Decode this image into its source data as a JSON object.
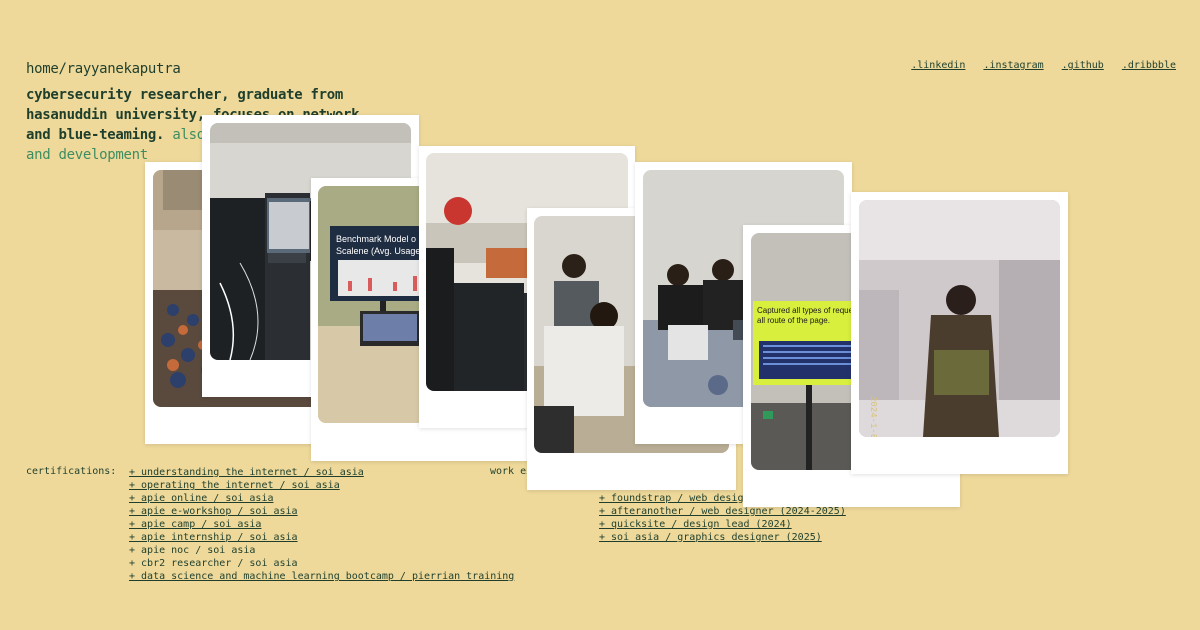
{
  "header": {
    "path": "home/rayyanekaputra",
    "bio_main": "cybersecurity researcher, graduate from hasanuddin university, focuses on network and blue-teaming.",
    "bio_extra": " also",
    "bio_extra_line": "and development _"
  },
  "social_links": [
    ".linkedin",
    ".instagram",
    ".github",
    ".dribbble"
  ],
  "certifications": {
    "label": "certifications:",
    "items": [
      {
        "text": "+ understanding the internet / soi asia",
        "linked": true
      },
      {
        "text": "+ operating the internet / soi asia",
        "linked": true
      },
      {
        "text": "+ apie online / soi asia",
        "linked": true
      },
      {
        "text": "+ apie e-workshop / soi asia",
        "linked": true
      },
      {
        "text": "+ apie camp / soi asia",
        "linked": true
      },
      {
        "text": "+ apie internship / soi asia",
        "linked": true
      },
      {
        "text": "+ apie noc / soi asia",
        "linked": false
      },
      {
        "text": "+ cbr2 researcher / soi asia",
        "linked": false
      },
      {
        "text": "+ data science and machine learning bootcamp / pierrian training",
        "linked": true
      }
    ]
  },
  "work": {
    "label": "work ex",
    "items": [
      {
        "text": "+ foundstrap / web designer",
        "linked": true
      },
      {
        "text": "+ afteranother / web designer (2024-2025)",
        "linked": true
      },
      {
        "text": "+ quicksite / design lead (2024)",
        "linked": true
      },
      {
        "text": "+ soi asia / graphics designer (2025)",
        "linked": true
      }
    ]
  },
  "photos": {
    "presentation_slide": "Benchmark Model o Scalene (Avg. Usage",
    "tv_slide": "Captured all types of request t all route of the page.",
    "stamp": "2024-1-8"
  }
}
